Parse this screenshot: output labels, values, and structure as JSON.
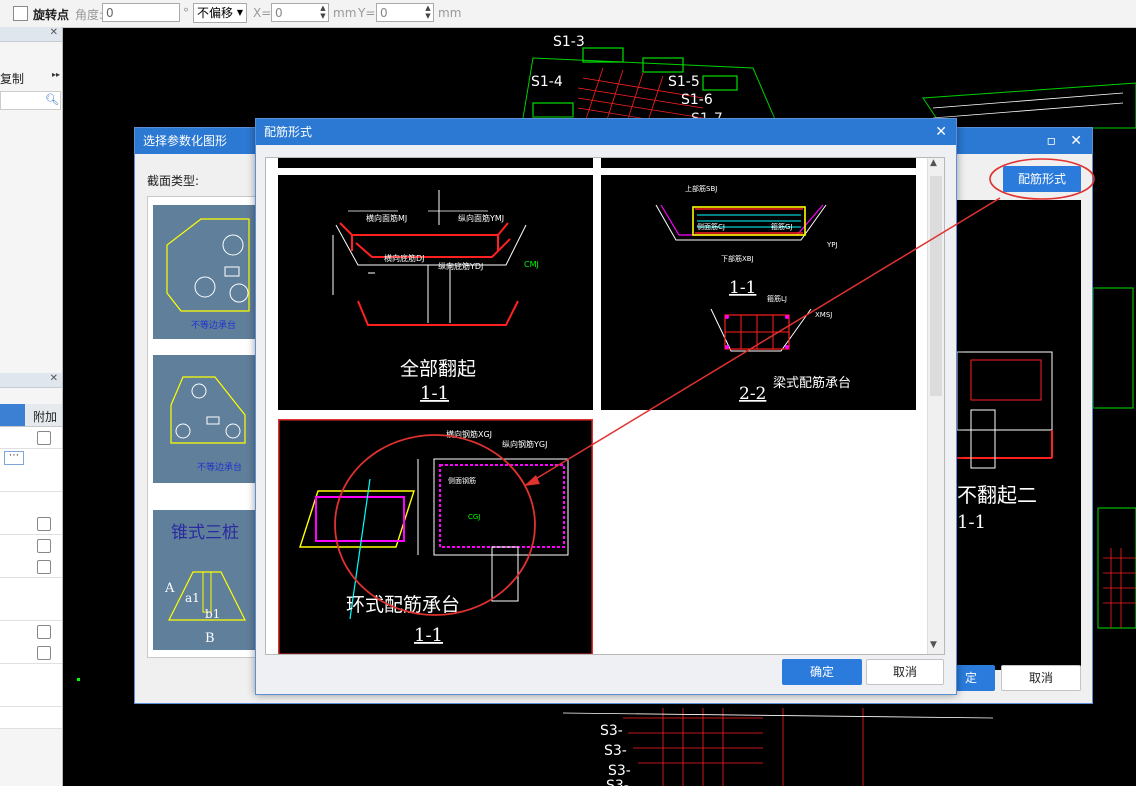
{
  "toolbar": {
    "rotate_point_label": "旋转点",
    "angle_label": "角度:",
    "angle_value": "0",
    "degree_unit": "°",
    "offset_mode": "不偏移",
    "x_label": "X=",
    "x_value": "0",
    "mm_label_1": "mm",
    "y_label": "Y=",
    "y_value": "0",
    "mm_label_2": "mm"
  },
  "left_panel": {
    "copy_label": "复制",
    "attach_header": "附加",
    "more_button": "⋯"
  },
  "param_dialog": {
    "title": "选择参数化图形",
    "section_type_label": "截面类型:",
    "thumb1_caption": "不等边承台",
    "thumb2_caption": "不等边承台",
    "thumb3_title": "锥式三桩",
    "thumb3_labels": [
      "A",
      "a1",
      "b1",
      "B"
    ],
    "rebar_form_button": "配筋形式",
    "confirm_button": "定",
    "cancel_button": "取消",
    "preview_title": "不翻起二",
    "preview_section": "1-1"
  },
  "rebar_dialog": {
    "title": "配筋形式",
    "confirm_button": "确定",
    "cancel_button": "取消",
    "options": [
      {
        "caption": "全部翻起",
        "section": "1-1",
        "labels": [
          "横向面筋MJ",
          "纵向面筋YMJ",
          "横向底筋DJ",
          "纵向底筋YDJ",
          "CMJ"
        ]
      },
      {
        "caption": "梁式配筋承台",
        "section_top": "1-1",
        "section_bottom": "2-2",
        "labels": [
          "上部筋SBJ",
          "侧面筋CJ",
          "箍筋GJ",
          "下部筋XBJ",
          "箍筋LJ",
          "YPJ",
          "XMSJ"
        ]
      },
      {
        "caption": "环式配筋承台",
        "section": "1-1",
        "labels": [
          "横向钢筋XGJ",
          "纵向钢筋YGJ",
          "侧面钢筋",
          "CGJ"
        ],
        "selected": true
      }
    ]
  },
  "cad_labels": [
    "S1-4",
    "S1-3",
    "S1-5",
    "S1-6",
    "S1-7",
    "S3-",
    "S3-",
    "S3-",
    "S3-"
  ],
  "colors": {
    "accent": "#2b79d2",
    "highlight": "#e0322f",
    "cad_green": "#00ff00",
    "cad_white": "#ffffff",
    "cad_red": "#ff2020",
    "cad_yellow": "#ffff00",
    "cad_magenta": "#ff00ff",
    "cad_cyan": "#00ffff"
  }
}
